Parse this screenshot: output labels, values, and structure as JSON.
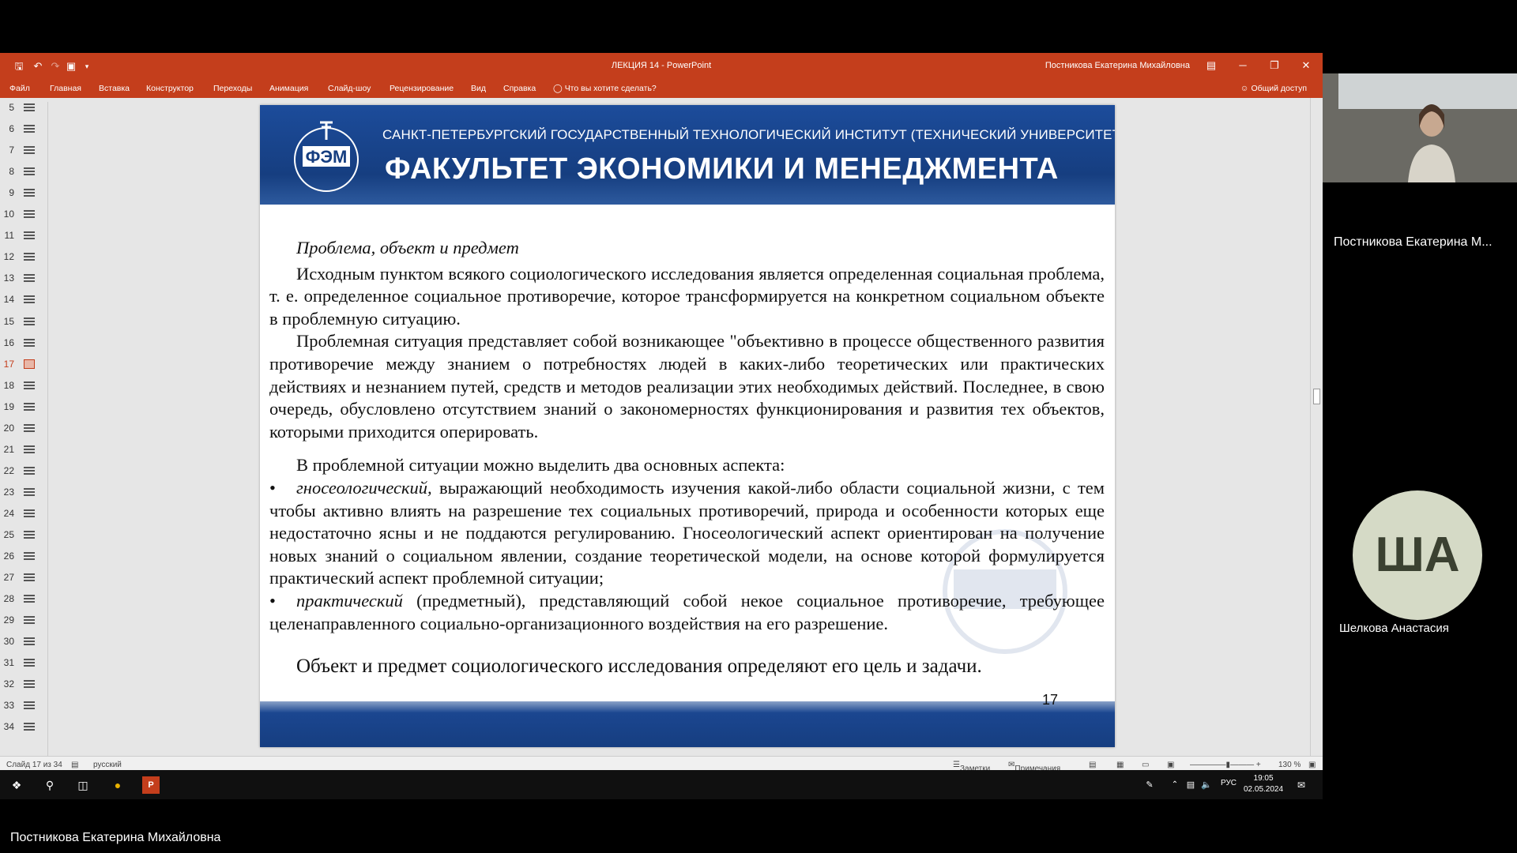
{
  "window": {
    "title": "ЛЕКЦИЯ 14  -  PowerPoint",
    "user": "Постникова Екатерина Михайловна",
    "share_label": "Общий доступ",
    "tell_me": "Что вы хотите сделать?",
    "minimize": "─",
    "restore": "❐",
    "close": "✕"
  },
  "ribbon_tabs": [
    "Файл",
    "Главная",
    "Вставка",
    "Конструктор",
    "Переходы",
    "Анимация",
    "Слайд-шоу",
    "Рецензирование",
    "Вид",
    "Справка"
  ],
  "thumbnails": {
    "numbers": [
      "5",
      "6",
      "7",
      "8",
      "9",
      "10",
      "11",
      "12",
      "13",
      "14",
      "15",
      "16",
      "17",
      "18",
      "19",
      "20",
      "21",
      "22",
      "23",
      "24",
      "25",
      "26",
      "27",
      "28",
      "29",
      "30",
      "31",
      "32",
      "33",
      "34"
    ],
    "active": "17"
  },
  "slide": {
    "institute": "САНКТ-ПЕТЕРБУРГСКИЙ ГОСУДАРСТВЕННЫЙ ТЕХНОЛОГИЧЕСКИЙ ИНСТИТУТ (ТЕХНИЧЕСКИЙ УНИВЕРСИТЕТ)",
    "faculty": "ФАКУЛЬТЕТ ЭКОНОМИКИ И МЕНЕДЖМЕНТА",
    "logo_text": "ФЭМ",
    "heading": "Проблема, объект и предмет",
    "para1": "Исходным пунктом всякого социологического исследования является определенная социальная проблема, т. е. определенное социальное противоречие, которое трансформируется на конкретном социальном объекте в проблемную ситуацию.",
    "para2": "Проблемная ситуация представляет собой возникающее \"объективно в процессе общественного развития противоречие между знанием о потребностях людей в каких-либо теоретических или практических действиях и незнанием путей, средств и методов реализации этих необходимых действий. Последнее, в свою очередь, обусловлено отсутствием знаний о закономерностях функционирования и развития тех объектов, которыми приходится оперировать.",
    "para3": "В проблемной ситуации можно выделить два основных аспекта:",
    "bullet_mark": "•",
    "bullet1_term": "гносеологический,",
    "bullet1_text": " выражающий необходимость изучения какой-либо области социальной жизни, с тем чтобы активно влиять на разрешение тех социальных противоречий, природа и особенности которых еще недостаточно ясны и не поддаются регулированию. Гносеологический аспект ориентирован на получение новых знаний о социальном явлении, создание теоретической модели, на основе которой формулируется практический аспект проблемной ситуации;",
    "bullet2_term": "практический",
    "bullet2_text": " (предметный), представляющий собой некое социальное противоречие, требующее целенаправленного социально-организационного воздействия на его разрешение.",
    "closing": "Объект и предмет социологического исследования определяют его цель и задачи.",
    "number": "17"
  },
  "status": {
    "slide_counter": "Слайд 17 из 34",
    "language": "русский",
    "notes": "Заметки",
    "comments": "Примечания",
    "zoom": "130 %"
  },
  "taskbar": {
    "lang": "РУС",
    "time": "19:05",
    "date": "02.05.2024"
  },
  "participants": {
    "camera_name": "Постникова Екатерина М...",
    "avatar_initials": "ША",
    "avatar_name": "Шелкова Анастасия",
    "presenter": "Постникова Екатерина Михайловна"
  },
  "colors": {
    "ppt_accent": "#c43e1c",
    "slide_header": "#163e80",
    "avatar_bg": "#d5dac6"
  }
}
